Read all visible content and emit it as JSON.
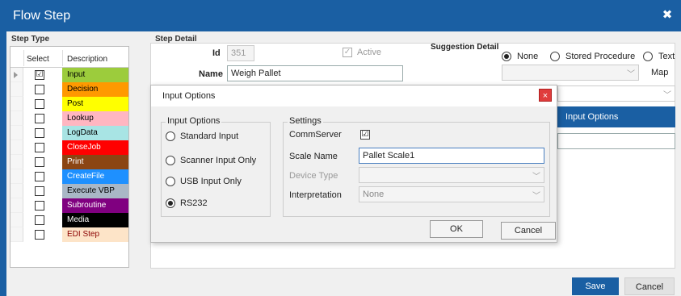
{
  "window": {
    "title": "Flow Step",
    "close_glyph": "✖"
  },
  "step_type": {
    "label": "Step Type",
    "col_select": "Select",
    "col_description": "Description",
    "rows": [
      {
        "label": "Input",
        "checked": "☑",
        "color": "#9ccc3c",
        "text_color": "#000"
      },
      {
        "label": "Decision",
        "checked": "",
        "color": "#ff9900",
        "text_color": "#000"
      },
      {
        "label": "Post",
        "checked": "",
        "color": "#ffff00",
        "text_color": "#000"
      },
      {
        "label": "Lookup",
        "checked": "",
        "color": "#ffb6c1",
        "text_color": "#000"
      },
      {
        "label": "LogData",
        "checked": "",
        "color": "#a8e4e4",
        "text_color": "#000"
      },
      {
        "label": "CloseJob",
        "checked": "",
        "color": "#ff0000",
        "text_color": "#fff"
      },
      {
        "label": "Print",
        "checked": "",
        "color": "#8b4513",
        "text_color": "#fff"
      },
      {
        "label": "CreateFile",
        "checked": "",
        "color": "#1e90ff",
        "text_color": "#fff"
      },
      {
        "label": "Execute VBP",
        "checked": "",
        "color": "#a9b7c6",
        "text_color": "#000"
      },
      {
        "label": "Subroutine",
        "checked": "",
        "color": "#800080",
        "text_color": "#fff"
      },
      {
        "label": "Media",
        "checked": "",
        "color": "#000000",
        "text_color": "#fff"
      },
      {
        "label": "EDI Step",
        "checked": "",
        "color": "#fde4c8",
        "text_color": "#8b0000"
      }
    ]
  },
  "step_detail": {
    "label": "Step Detail",
    "id_label": "Id",
    "id_value": "351",
    "active_label": "Active",
    "name_label": "Name",
    "name_value": "Weigh Pallet",
    "input_options_band": "Input Options"
  },
  "suggestion": {
    "label": "Suggestion Detail",
    "opt_none": "None",
    "opt_stored": "Stored Procedure",
    "opt_text": "Text",
    "map_label": "Map"
  },
  "modal": {
    "title": "Input Options",
    "close_glyph": "×",
    "input_options_label": "Input Options",
    "options": [
      "Standard Input",
      "Scanner Input Only",
      "USB Input Only",
      "RS232"
    ],
    "settings_label": "Settings",
    "commserver_label": "CommServer",
    "commserver_checked": "☑",
    "scale_name_label": "Scale Name",
    "scale_name_value": "Pallet Scale1",
    "device_type_label": "Device Type",
    "interpretation_label": "Interpretation",
    "interpretation_value": "None",
    "ok_label": "OK",
    "cancel_label": "Cancel"
  },
  "footer": {
    "save_label": "Save",
    "cancel_label": "Cancel"
  },
  "colors": {
    "accent": "#1a5fa3",
    "close_red": "#e03c3c"
  },
  "icons": {
    "dropdown": "chevron-down-icon",
    "check": "check-icon"
  }
}
